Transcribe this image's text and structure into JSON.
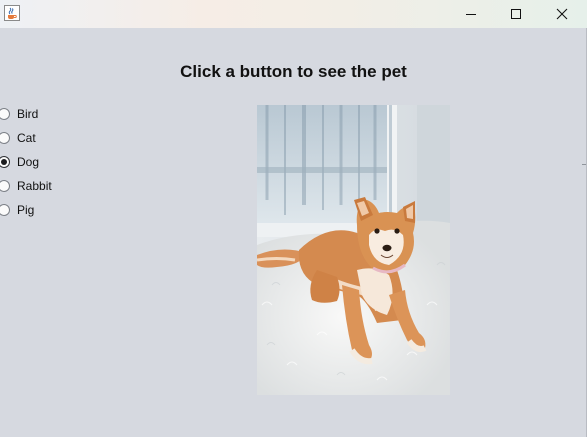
{
  "window": {
    "app_icon": "java-cup-icon",
    "controls": [
      "minimize-icon",
      "maximize-icon",
      "close-icon"
    ]
  },
  "heading": "Click a button to see the pet",
  "pets": [
    {
      "label": "Bird",
      "selected": false
    },
    {
      "label": "Cat",
      "selected": false
    },
    {
      "label": "Dog",
      "selected": true
    },
    {
      "label": "Rabbit",
      "selected": false
    },
    {
      "label": "Pig",
      "selected": false
    }
  ],
  "image": {
    "subject": "dog",
    "description_icon": "shiba-inu-photo"
  }
}
